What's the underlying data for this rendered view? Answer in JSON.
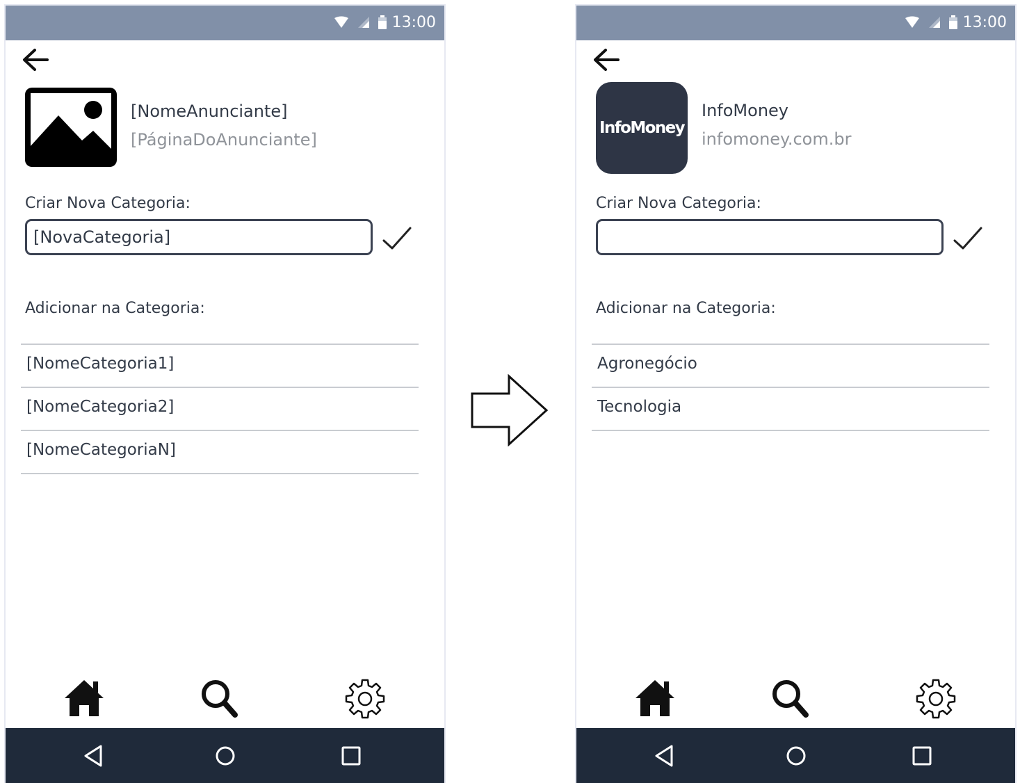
{
  "status_bar": {
    "time": "13:00"
  },
  "screens": {
    "template": {
      "advertiser": {
        "name": "[NomeAnunciante]",
        "page": "[PáginaDoAnunciante]"
      },
      "create_label": "Criar Nova Categoria:",
      "new_category_value": "[NovaCategoria]",
      "add_label": "Adicionar na Categoria:",
      "categories": [
        "[NomeCategoria1]",
        "[NomeCategoria2]",
        "[NomeCategoriaN]"
      ]
    },
    "example": {
      "advertiser": {
        "name": "InfoMoney",
        "page": "infomoney.com.br",
        "logo_text": "InfoMoney"
      },
      "create_label": "Criar Nova Categoria:",
      "new_category_value": "",
      "add_label": "Adicionar na Categoria:",
      "categories": [
        "Agronegócio",
        "Tecnologia"
      ]
    }
  },
  "icons": {
    "status": [
      "wifi-icon",
      "signal-icon",
      "battery-icon"
    ],
    "top": [
      "back-arrow-icon"
    ],
    "confirm": "checkmark-icon",
    "bottom_nav": [
      "home-icon",
      "search-icon",
      "gear-icon"
    ],
    "system_nav": [
      "back-triangle-icon",
      "home-circle-icon",
      "recents-square-icon"
    ],
    "flow": "right-arrow-icon"
  },
  "colors": {
    "status_bar": "#8190a8",
    "system_bar": "#1f2a3a",
    "text": "#333b48",
    "secondary_text": "#8f9399",
    "logo_bg": "#2e3545",
    "divider": "#c9ccd1"
  }
}
